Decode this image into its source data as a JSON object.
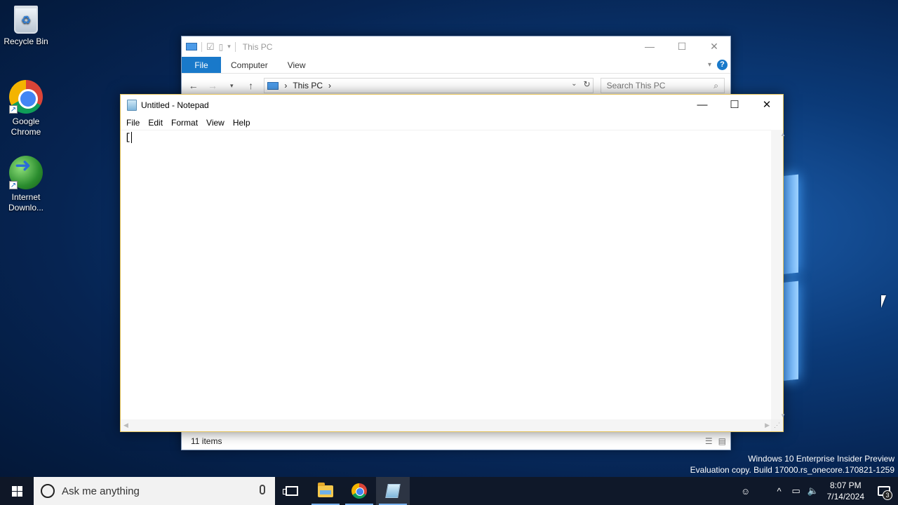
{
  "desktop": {
    "icons": [
      {
        "label": "Recycle Bin",
        "icon": "recycle-bin-icon"
      },
      {
        "label": "Google\nChrome",
        "icon": "chrome-icon"
      },
      {
        "label": "Internet\nDownlo...",
        "icon": "internet-download-manager-icon"
      }
    ],
    "watermark": {
      "line1": "Windows 10 Enterprise Insider Preview",
      "line2": "Evaluation copy. Build 17000.rs_onecore.170821-1259"
    }
  },
  "explorer": {
    "title": "This PC",
    "tabs": {
      "file": "File",
      "computer": "Computer",
      "view": "View"
    },
    "help": "?",
    "address_path": "This PC",
    "search_placeholder": "Search This PC",
    "status_items": "11 items"
  },
  "notepad": {
    "title": "Untitled - Notepad",
    "menu": {
      "file": "File",
      "edit": "Edit",
      "format": "Format",
      "view": "View",
      "help": "Help"
    },
    "content": "["
  },
  "taskbar": {
    "search_placeholder": "Ask me anything",
    "time": "8:07 PM",
    "date": "7/14/2024",
    "notification_count": "3"
  },
  "colors": {
    "explorer_file_tab": "#1979ca",
    "notepad_border": "#e5c35a",
    "desktop_bg": "#0b3a78"
  }
}
